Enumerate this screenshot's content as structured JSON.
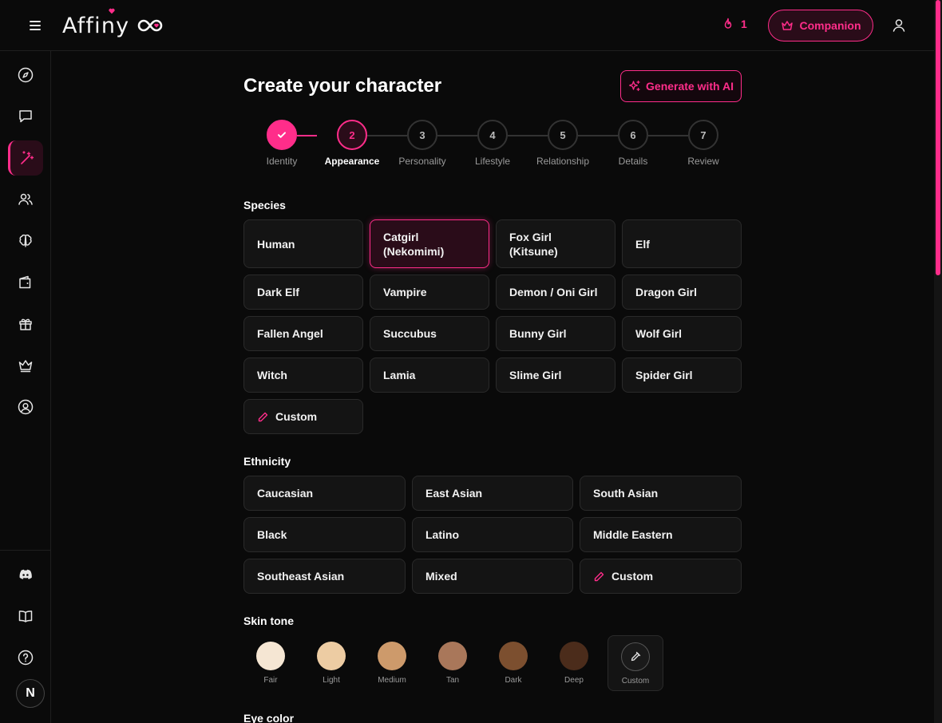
{
  "app": {
    "logo_text": "Affiny"
  },
  "header": {
    "streak_count": "1",
    "companion_label": "Companion"
  },
  "sidebar": {
    "top_items": [
      "compass-icon",
      "chat-icon",
      "magic-wand-icon",
      "users-icon",
      "brain-icon",
      "wallet-icon",
      "gift-icon",
      "crown-icon",
      "user-circle-icon"
    ],
    "bottom_items": [
      "discord-icon",
      "book-icon",
      "help-icon"
    ],
    "avatar_initial": "N"
  },
  "page": {
    "title": "Create your character",
    "generate_label": "Generate with AI"
  },
  "stepper": {
    "steps": [
      {
        "num": "1",
        "label": "Identity",
        "state": "done"
      },
      {
        "num": "2",
        "label": "Appearance",
        "state": "current"
      },
      {
        "num": "3",
        "label": "Personality",
        "state": "todo"
      },
      {
        "num": "4",
        "label": "Lifestyle",
        "state": "todo"
      },
      {
        "num": "5",
        "label": "Relationship",
        "state": "todo"
      },
      {
        "num": "6",
        "label": "Details",
        "state": "todo"
      },
      {
        "num": "7",
        "label": "Review",
        "state": "todo"
      }
    ]
  },
  "species": {
    "label": "Species",
    "options": [
      "Human",
      "Catgirl (Nekomimi)",
      "Fox Girl (Kitsune)",
      "Elf",
      "Dark Elf",
      "Vampire",
      "Demon / Oni Girl",
      "Dragon Girl",
      "Fallen Angel",
      "Succubus",
      "Bunny Girl",
      "Wolf Girl",
      "Witch",
      "Lamia",
      "Slime Girl",
      "Spider Girl"
    ],
    "selected": "Catgirl (Nekomimi)",
    "custom_label": "Custom"
  },
  "ethnicity": {
    "label": "Ethnicity",
    "options": [
      "Caucasian",
      "East Asian",
      "South Asian",
      "Black",
      "Latino",
      "Middle Eastern",
      "Southeast Asian",
      "Mixed"
    ],
    "custom_label": "Custom"
  },
  "skin_tone": {
    "label": "Skin tone",
    "options": [
      {
        "label": "Fair",
        "color": "#f5e6d3"
      },
      {
        "label": "Light",
        "color": "#edcca3"
      },
      {
        "label": "Medium",
        "color": "#cd9a6b"
      },
      {
        "label": "Tan",
        "color": "#a9775a"
      },
      {
        "label": "Dark",
        "color": "#7c4f2f"
      },
      {
        "label": "Deep",
        "color": "#4b2c1b"
      }
    ],
    "custom_label": "Custom"
  },
  "eye_color": {
    "label": "Eye color"
  },
  "colors": {
    "accent": "#ff2d8a",
    "background": "#0a0a0a",
    "card": "#141414"
  }
}
